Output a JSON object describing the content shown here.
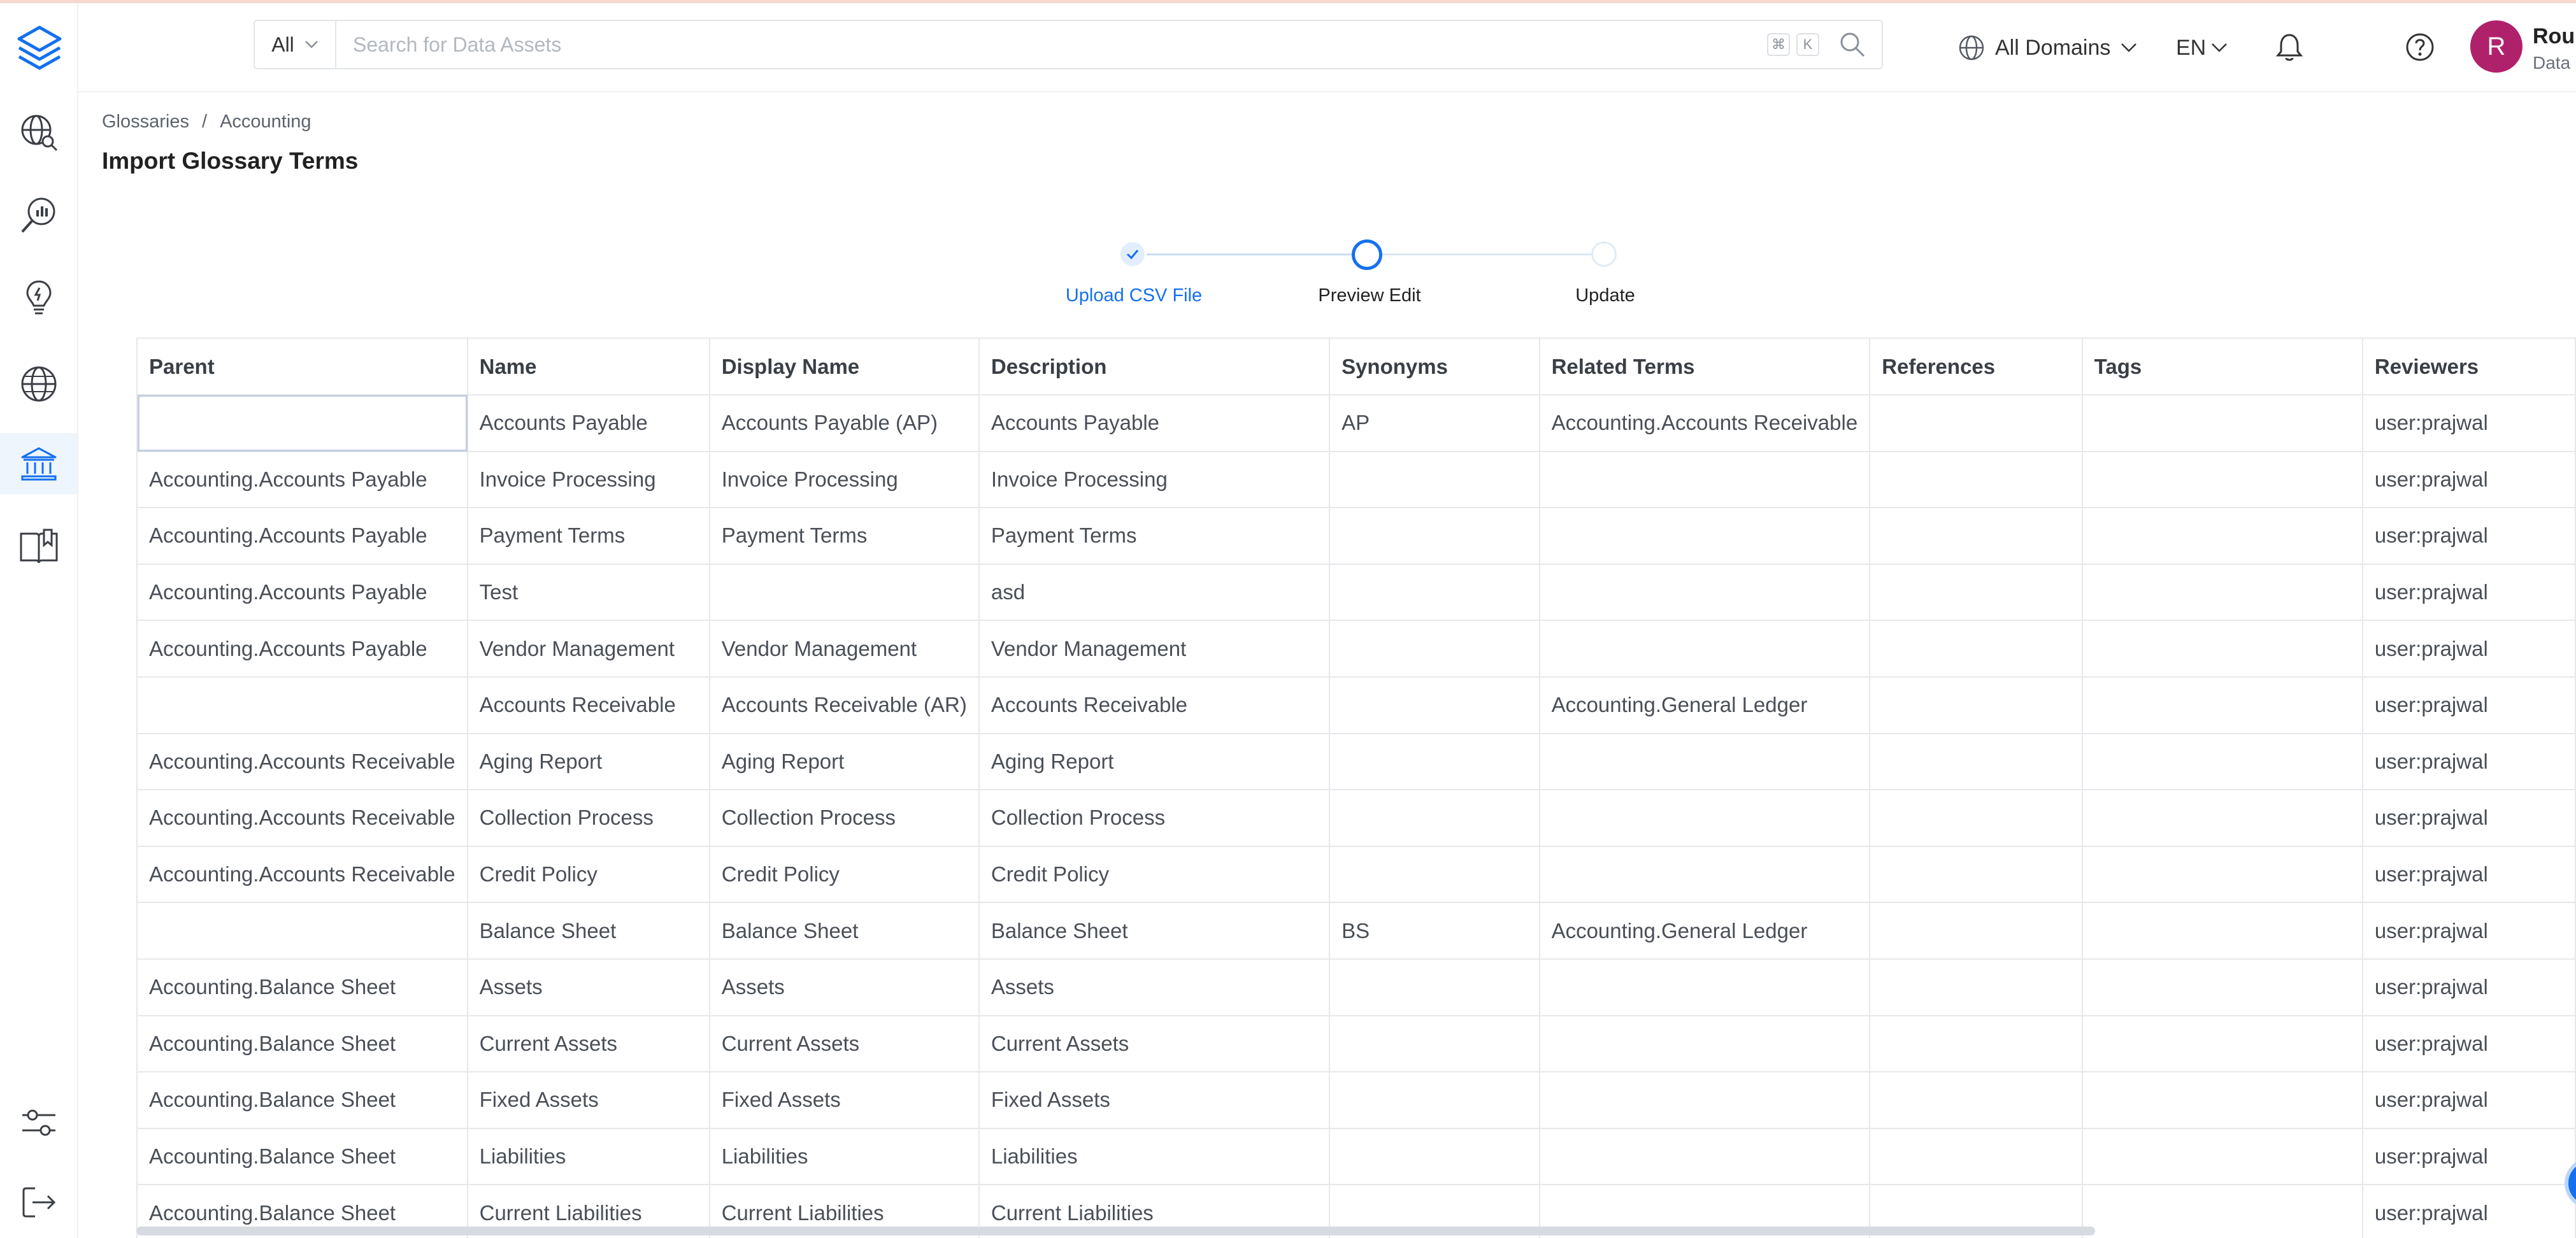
{
  "sidebar": {
    "logo_icon": "layers-logo-icon",
    "items": [
      {
        "name": "explore",
        "icon": "globe-search-icon"
      },
      {
        "name": "data-quality",
        "icon": "magnifier-chart-icon"
      },
      {
        "name": "insights",
        "icon": "lightbulb-icon"
      },
      {
        "name": "domains",
        "icon": "globe-icon"
      },
      {
        "name": "governance",
        "icon": "bank-icon",
        "active": true
      },
      {
        "name": "glossary",
        "icon": "book-icon"
      }
    ],
    "bottom": [
      {
        "name": "settings",
        "icon": "sliders-icon"
      },
      {
        "name": "logout",
        "icon": "logout-icon"
      }
    ]
  },
  "header": {
    "search_type": "All",
    "search_placeholder": "Search for Data Assets",
    "shortcut_keys": [
      "⌘",
      "K"
    ],
    "domains_label": "All Domains",
    "language": "EN",
    "avatar_initial": "R",
    "user_name": "Rounakpreet",
    "user_role": "Data Steward"
  },
  "breadcrumb": [
    "Glossaries",
    "/",
    "Accounting"
  ],
  "page_title": "Import Glossary Terms",
  "stepper": {
    "steps": [
      "Upload CSV File",
      "Preview Edit",
      "Update"
    ],
    "current": 1,
    "accent": "#1470ef"
  },
  "table": {
    "columns": [
      "Parent",
      "Name",
      "Display Name",
      "Description",
      "Synonyms",
      "Related Terms",
      "References",
      "Tags",
      "Reviewers"
    ],
    "rows": [
      [
        "",
        "Accounts Payable",
        "Accounts Payable (AP)",
        "Accounts Payable",
        "AP",
        "Accounting.Accounts Receivable",
        "",
        "",
        "user:prajwal"
      ],
      [
        "Accounting.Accounts Payable",
        "Invoice Processing",
        "Invoice Processing",
        "Invoice Processing",
        "",
        "",
        "",
        "",
        "user:prajwal"
      ],
      [
        "Accounting.Accounts Payable",
        "Payment Terms",
        "Payment Terms",
        "Payment Terms",
        "",
        "",
        "",
        "",
        "user:prajwal"
      ],
      [
        "Accounting.Accounts Payable",
        "Test",
        "",
        "asd",
        "",
        "",
        "",
        "",
        "user:prajwal"
      ],
      [
        "Accounting.Accounts Payable",
        "Vendor Management",
        "Vendor Management",
        "Vendor Management",
        "",
        "",
        "",
        "",
        "user:prajwal"
      ],
      [
        "",
        "Accounts Receivable",
        "Accounts Receivable (AR)",
        "Accounts Receivable",
        "",
        "Accounting.General Ledger",
        "",
        "",
        "user:prajwal"
      ],
      [
        "Accounting.Accounts Receivable",
        "Aging Report",
        "Aging Report",
        "Aging Report",
        "",
        "",
        "",
        "",
        "user:prajwal"
      ],
      [
        "Accounting.Accounts Receivable",
        "Collection Process",
        "Collection Process",
        "Collection Process",
        "",
        "",
        "",
        "",
        "user:prajwal"
      ],
      [
        "Accounting.Accounts Receivable",
        "Credit Policy",
        "Credit Policy",
        "Credit Policy",
        "",
        "",
        "",
        "",
        "user:prajwal"
      ],
      [
        "",
        "Balance Sheet",
        "Balance Sheet",
        "Balance Sheet",
        "BS",
        "Accounting.General Ledger",
        "",
        "",
        "user:prajwal"
      ],
      [
        "Accounting.Balance Sheet",
        "Assets",
        "Assets",
        "Assets",
        "",
        "",
        "",
        "",
        "user:prajwal"
      ],
      [
        "Accounting.Balance Sheet",
        "Current Assets",
        "Current Assets",
        "Current Assets",
        "",
        "",
        "",
        "",
        "user:prajwal"
      ],
      [
        "Accounting.Balance Sheet",
        "Fixed Assets",
        "Fixed Assets",
        "Fixed Assets",
        "",
        "",
        "",
        "",
        "user:prajwal"
      ],
      [
        "Accounting.Balance Sheet",
        "Liabilities",
        "Liabilities",
        "Liabilities",
        "",
        "",
        "",
        "",
        "user:prajwal"
      ],
      [
        "Accounting.Balance Sheet",
        "Current Liabilities",
        "Current Liabilities",
        "Current Liabilities",
        "",
        "",
        "",
        "",
        "user:prajwal"
      ]
    ]
  }
}
